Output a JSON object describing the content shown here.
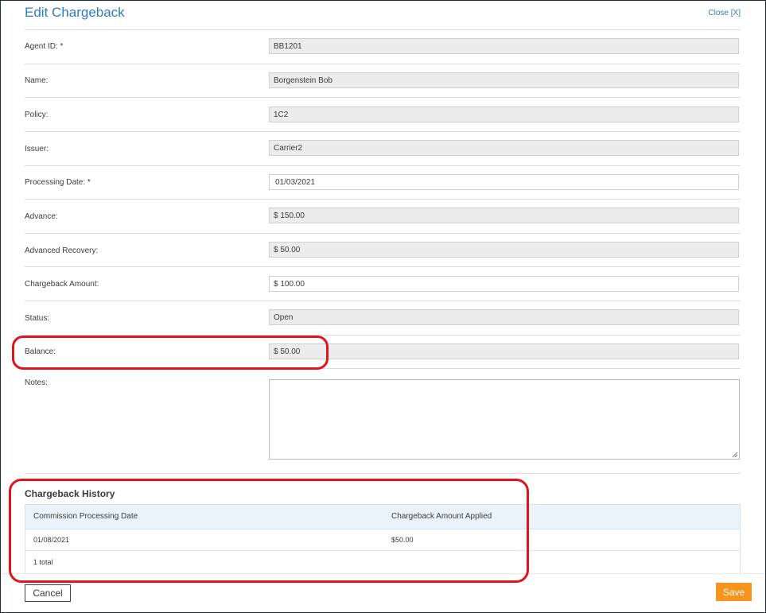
{
  "window": {
    "title": "Edit Chargeback",
    "close_label": "Close [X]"
  },
  "fields": [
    {
      "label": "Agent ID: *",
      "value": "BB1201",
      "editable": false
    },
    {
      "label": "Name:",
      "value": "Borgenstein Bob",
      "editable": false
    },
    {
      "label": "Policy:",
      "value": "1C2",
      "editable": false
    },
    {
      "label": "Issuer:",
      "value": "Carrier2",
      "editable": false
    },
    {
      "label": "Processing Date: *",
      "value": "01/03/2021",
      "editable": true
    },
    {
      "label": "Advance:",
      "value": "$ 150.00",
      "editable": false
    },
    {
      "label": "Advanced Recovery:",
      "value": "$ 50.00",
      "editable": false
    },
    {
      "label": "Chargeback Amount:",
      "value": "$ 100.00",
      "editable": true
    },
    {
      "label": "Status:",
      "value": "Open",
      "editable": false
    },
    {
      "label": "Balance:",
      "value": "$ 50.00",
      "editable": false
    }
  ],
  "notes": {
    "label": "Notes:",
    "value": ""
  },
  "history": {
    "title": "Chargeback History",
    "columns": [
      "Commission Processing Date",
      "Chargeback Amount Applied"
    ],
    "rows": [
      [
        "01/08/2021",
        "$50.00"
      ]
    ],
    "total_text": "1 total"
  },
  "footer": {
    "cancel_label": "Cancel",
    "save_label": "Save"
  },
  "colors": {
    "accent": "#2e7cc0",
    "save_button": "#f7941d",
    "highlight": "#e0141e",
    "table_header": "#eaf3fb"
  }
}
